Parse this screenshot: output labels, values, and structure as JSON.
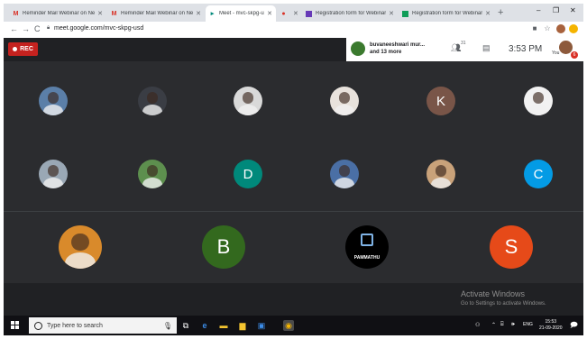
{
  "browser": {
    "tabs": [
      {
        "title": "Reminder Mail Webinar on Ne",
        "favicon": "gmail-icon",
        "color": "#d93025",
        "active": false
      },
      {
        "title": "Reminder Mail Webinar on Ne",
        "favicon": "gmail-icon",
        "color": "#d93025",
        "active": false
      },
      {
        "title": "Meet - mvc-skpg-usd",
        "favicon": "meet-icon",
        "color": "#00897b",
        "active": true
      },
      {
        "title": "",
        "favicon": "recording-icon",
        "color": "#d93025",
        "active": false
      },
      {
        "title": "Registration form for Webinar",
        "favicon": "forms-icon",
        "color": "#673ab7",
        "active": false
      },
      {
        "title": "Registration form for Webinar",
        "favicon": "sheets-icon",
        "color": "#0f9d58",
        "active": false
      }
    ],
    "new_tab": "+",
    "window_controls": [
      "–",
      "❐",
      "✕"
    ],
    "url": "meet.google.com/mvc-skpg-usd"
  },
  "meet": {
    "rec_label": "REC",
    "participant_summary_line1": "buvaneeshwari mur...",
    "participant_summary_line2": "and 13 more",
    "people_count": "31",
    "time": "3:53 PM",
    "you_label": "You",
    "notification_count": "6",
    "tiles": [
      {
        "kind": "photo",
        "initial": "",
        "label": "",
        "color": "#5b7fa8"
      },
      {
        "kind": "photo",
        "initial": "",
        "label": "",
        "color": "#3a3d44"
      },
      {
        "kind": "photo",
        "initial": "",
        "label": "",
        "color": "#d9d9d9"
      },
      {
        "kind": "photo",
        "initial": "",
        "label": "",
        "color": "#e8e2dc"
      },
      {
        "kind": "letter",
        "initial": "K",
        "label": "",
        "color": "#795548"
      },
      {
        "kind": "photo",
        "initial": "",
        "label": "",
        "color": "#f2f2f2"
      },
      {
        "kind": "photo",
        "initial": "",
        "label": "",
        "color": "#9aa8b5"
      },
      {
        "kind": "photo",
        "initial": "",
        "label": "",
        "color": "#5d8f4e"
      },
      {
        "kind": "letter",
        "initial": "D",
        "label": "",
        "color": "#00897b"
      },
      {
        "kind": "photo",
        "initial": "",
        "label": "",
        "color": "#4a6fa5"
      },
      {
        "kind": "photo",
        "initial": "",
        "label": "",
        "color": "#c9a27a"
      },
      {
        "kind": "letter",
        "initial": "C",
        "label": "",
        "color": "#039be5"
      },
      {
        "kind": "photo",
        "initial": "",
        "label": "",
        "color": "#d98a2b"
      },
      {
        "kind": "letter",
        "initial": "B",
        "label": "",
        "color": "#33691e"
      },
      {
        "kind": "logo",
        "initial": "",
        "label": "PAMMATHU",
        "color": "#000000"
      },
      {
        "kind": "letter",
        "initial": "S",
        "label": "",
        "color": "#e64a19"
      }
    ],
    "watermark_title": "Activate Windows",
    "watermark_sub": "Go to Settings to activate Windows."
  },
  "taskbar": {
    "search_placeholder": "Type here to search",
    "lang": "ENG",
    "clock_time": "15:53",
    "clock_date": "21-09-2020"
  }
}
